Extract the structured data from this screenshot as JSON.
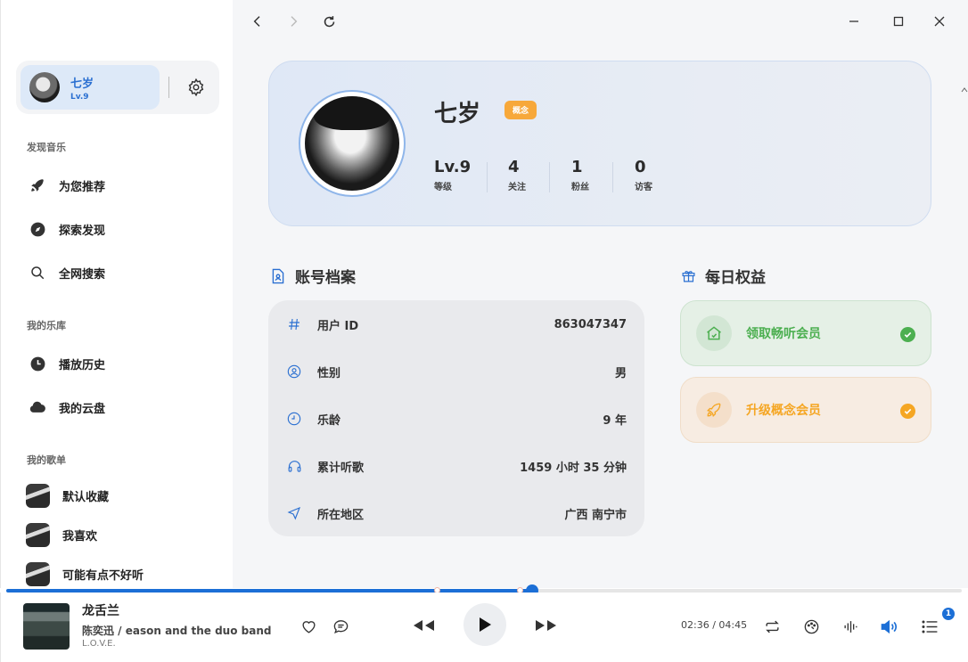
{
  "sidebar": {
    "user": {
      "name": "七岁",
      "level": "Lv.9"
    },
    "sections": {
      "discover": "发现音乐",
      "library": "我的乐库",
      "playlists": "我的歌单"
    },
    "discover_items": [
      {
        "label": "为您推荐",
        "icon": "rocket-icon"
      },
      {
        "label": "探索发现",
        "icon": "compass-icon"
      },
      {
        "label": "全网搜索",
        "icon": "search-icon"
      }
    ],
    "library_items": [
      {
        "label": "播放历史",
        "icon": "clock-icon"
      },
      {
        "label": "我的云盘",
        "icon": "cloud-icon"
      }
    ],
    "playlist_items": [
      {
        "label": "默认收藏"
      },
      {
        "label": "我喜欢"
      },
      {
        "label": "可能有点不好听"
      }
    ]
  },
  "profile": {
    "name": "七岁",
    "badge": "概念",
    "stats": [
      {
        "value": "Lv.9",
        "label": "等级"
      },
      {
        "value": "4",
        "label": "关注"
      },
      {
        "value": "1",
        "label": "粉丝"
      },
      {
        "value": "0",
        "label": "访客"
      }
    ]
  },
  "account": {
    "title": "账号档案",
    "rows": [
      {
        "icon": "hash-icon",
        "key": "用户 ID",
        "value": "863047347"
      },
      {
        "icon": "user-circle-icon",
        "key": "性别",
        "value": "男"
      },
      {
        "icon": "clock-icon",
        "key": "乐龄",
        "value": "9 年"
      },
      {
        "icon": "headphones-icon",
        "key": "累计听歌",
        "value": "1459 小时 35 分钟"
      },
      {
        "icon": "location-icon",
        "key": "所在地区",
        "value": "广西 南宁市"
      }
    ]
  },
  "perks": {
    "title": "每日权益",
    "items": [
      {
        "label": "领取畅听会员",
        "color": "#4caf50",
        "icon": "home-icon"
      },
      {
        "label": "升级概念会员",
        "color": "#f5a623",
        "icon": "rocket-icon"
      }
    ]
  },
  "player": {
    "title": "龙舌兰",
    "artist": "陈奕迅 / eason and the duo band",
    "album": "L.O.V.E.",
    "time": "02:36 / 04:45",
    "progress": 0.55,
    "queue_count": "1"
  },
  "colors": {
    "accent": "#1c6fd6",
    "green": "#4caf50",
    "orange": "#f5a623"
  }
}
